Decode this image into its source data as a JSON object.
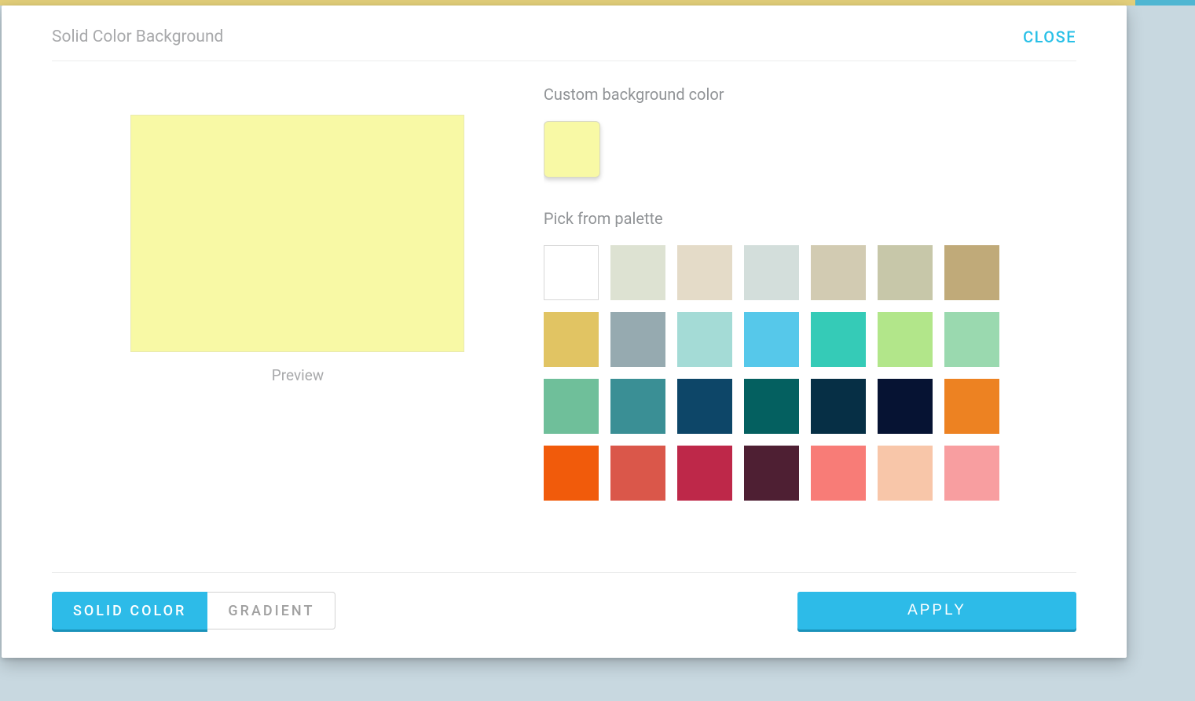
{
  "header": {
    "title": "Solid Color Background",
    "close_label": "CLOSE"
  },
  "preview": {
    "label": "Preview",
    "color": "#f8f9a5"
  },
  "custom": {
    "label": "Custom background color",
    "value": "#f8f9a5"
  },
  "palette": {
    "label": "Pick from palette",
    "colors": [
      "#ffffff",
      "#dde2d2",
      "#e4dbc8",
      "#d3dedb",
      "#d2cbb2",
      "#c7c7a9",
      "#c0aa79",
      "#e1c463",
      "#96aab0",
      "#a4dbd6",
      "#56c8ea",
      "#35cbb7",
      "#b2e68a",
      "#9ad9af",
      "#6fbf9a",
      "#3a8f95",
      "#0d4668",
      "#046060",
      "#062f45",
      "#061333",
      "#ed8222",
      "#f15b0b",
      "#da574a",
      "#be2849",
      "#4e1f33",
      "#f87c77",
      "#f8c6a9",
      "#f89ea0"
    ]
  },
  "footer": {
    "solid_label": "SOLID COLOR",
    "gradient_label": "GRADIENT",
    "apply_label": "APPLY",
    "active_tab": "solid"
  }
}
